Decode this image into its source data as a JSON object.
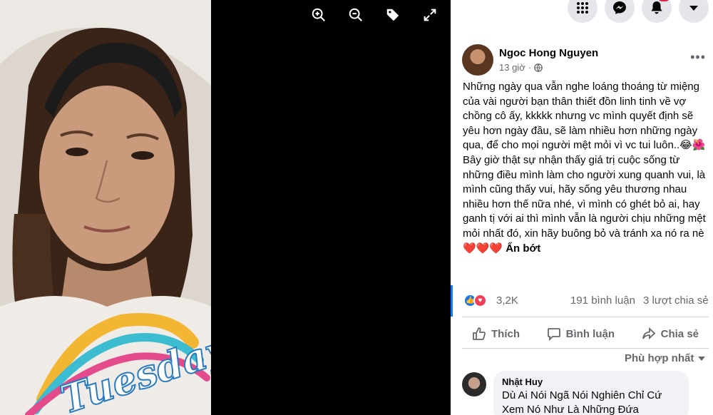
{
  "viewer": {
    "overlay_text": "Tuesday",
    "toolbar": [
      {
        "name": "zoom-in-icon"
      },
      {
        "name": "zoom-out-icon"
      },
      {
        "name": "tag-icon"
      },
      {
        "name": "fullscreen-icon"
      }
    ]
  },
  "topbar": {
    "buttons": [
      "menu-grid-icon",
      "messenger-icon",
      "bell-icon",
      "caret-down-icon"
    ]
  },
  "post": {
    "author": "Ngoc Hong Nguyen",
    "time": "13 giờ",
    "privacy_icon": "globe-icon",
    "paragraph1": "Những ngày qua vẫn nghe loáng thoáng từ miệng của vài người bạn thân thiết đồn linh tinh về vợ chồng cô ấy, kkkkk nhưng vc mình quyết định sẽ yêu hơn ngày đầu, sẽ làm nhiều hơn những ngày qua, để cho mọi người mệt mỏi vì vc tui luôn..😂🌺",
    "paragraph2": "Bây giờ thật sự nhận thấy giá trị cuộc sống từ những điều mình làm cho người xung quanh vui, là mình cũng thấy vui, hãy sống yêu thương nhau nhiều hơn thế nữa nhé, vì mình có ghét bỏ ai, hay ganh tị với ai thì mình vẫn là người chịu những mệt mỏi nhất đó, xin hãy buông bỏ và tránh xa nó ra nè❤️❤️❤️",
    "hide_link": "Ẩn bớt"
  },
  "stats": {
    "reactions": "3,2K",
    "comments": "191 bình luận",
    "shares": "3 lượt chia sẻ"
  },
  "actions": {
    "like": "Thích",
    "comment": "Bình luận",
    "share": "Chia sẻ"
  },
  "sort": {
    "label": "Phù hợp nhất"
  },
  "comment": {
    "name": "Nhật Huy",
    "text": "Dù Ai Nói Ngã Nói Nghiên Chỉ Cứ Xem Nó Như Là Những Đứa"
  },
  "colors": {
    "accent": "#1877f2",
    "text": "#050505",
    "muted": "#65676b",
    "love": "#f33e58",
    "badge": "#e41e3f"
  }
}
